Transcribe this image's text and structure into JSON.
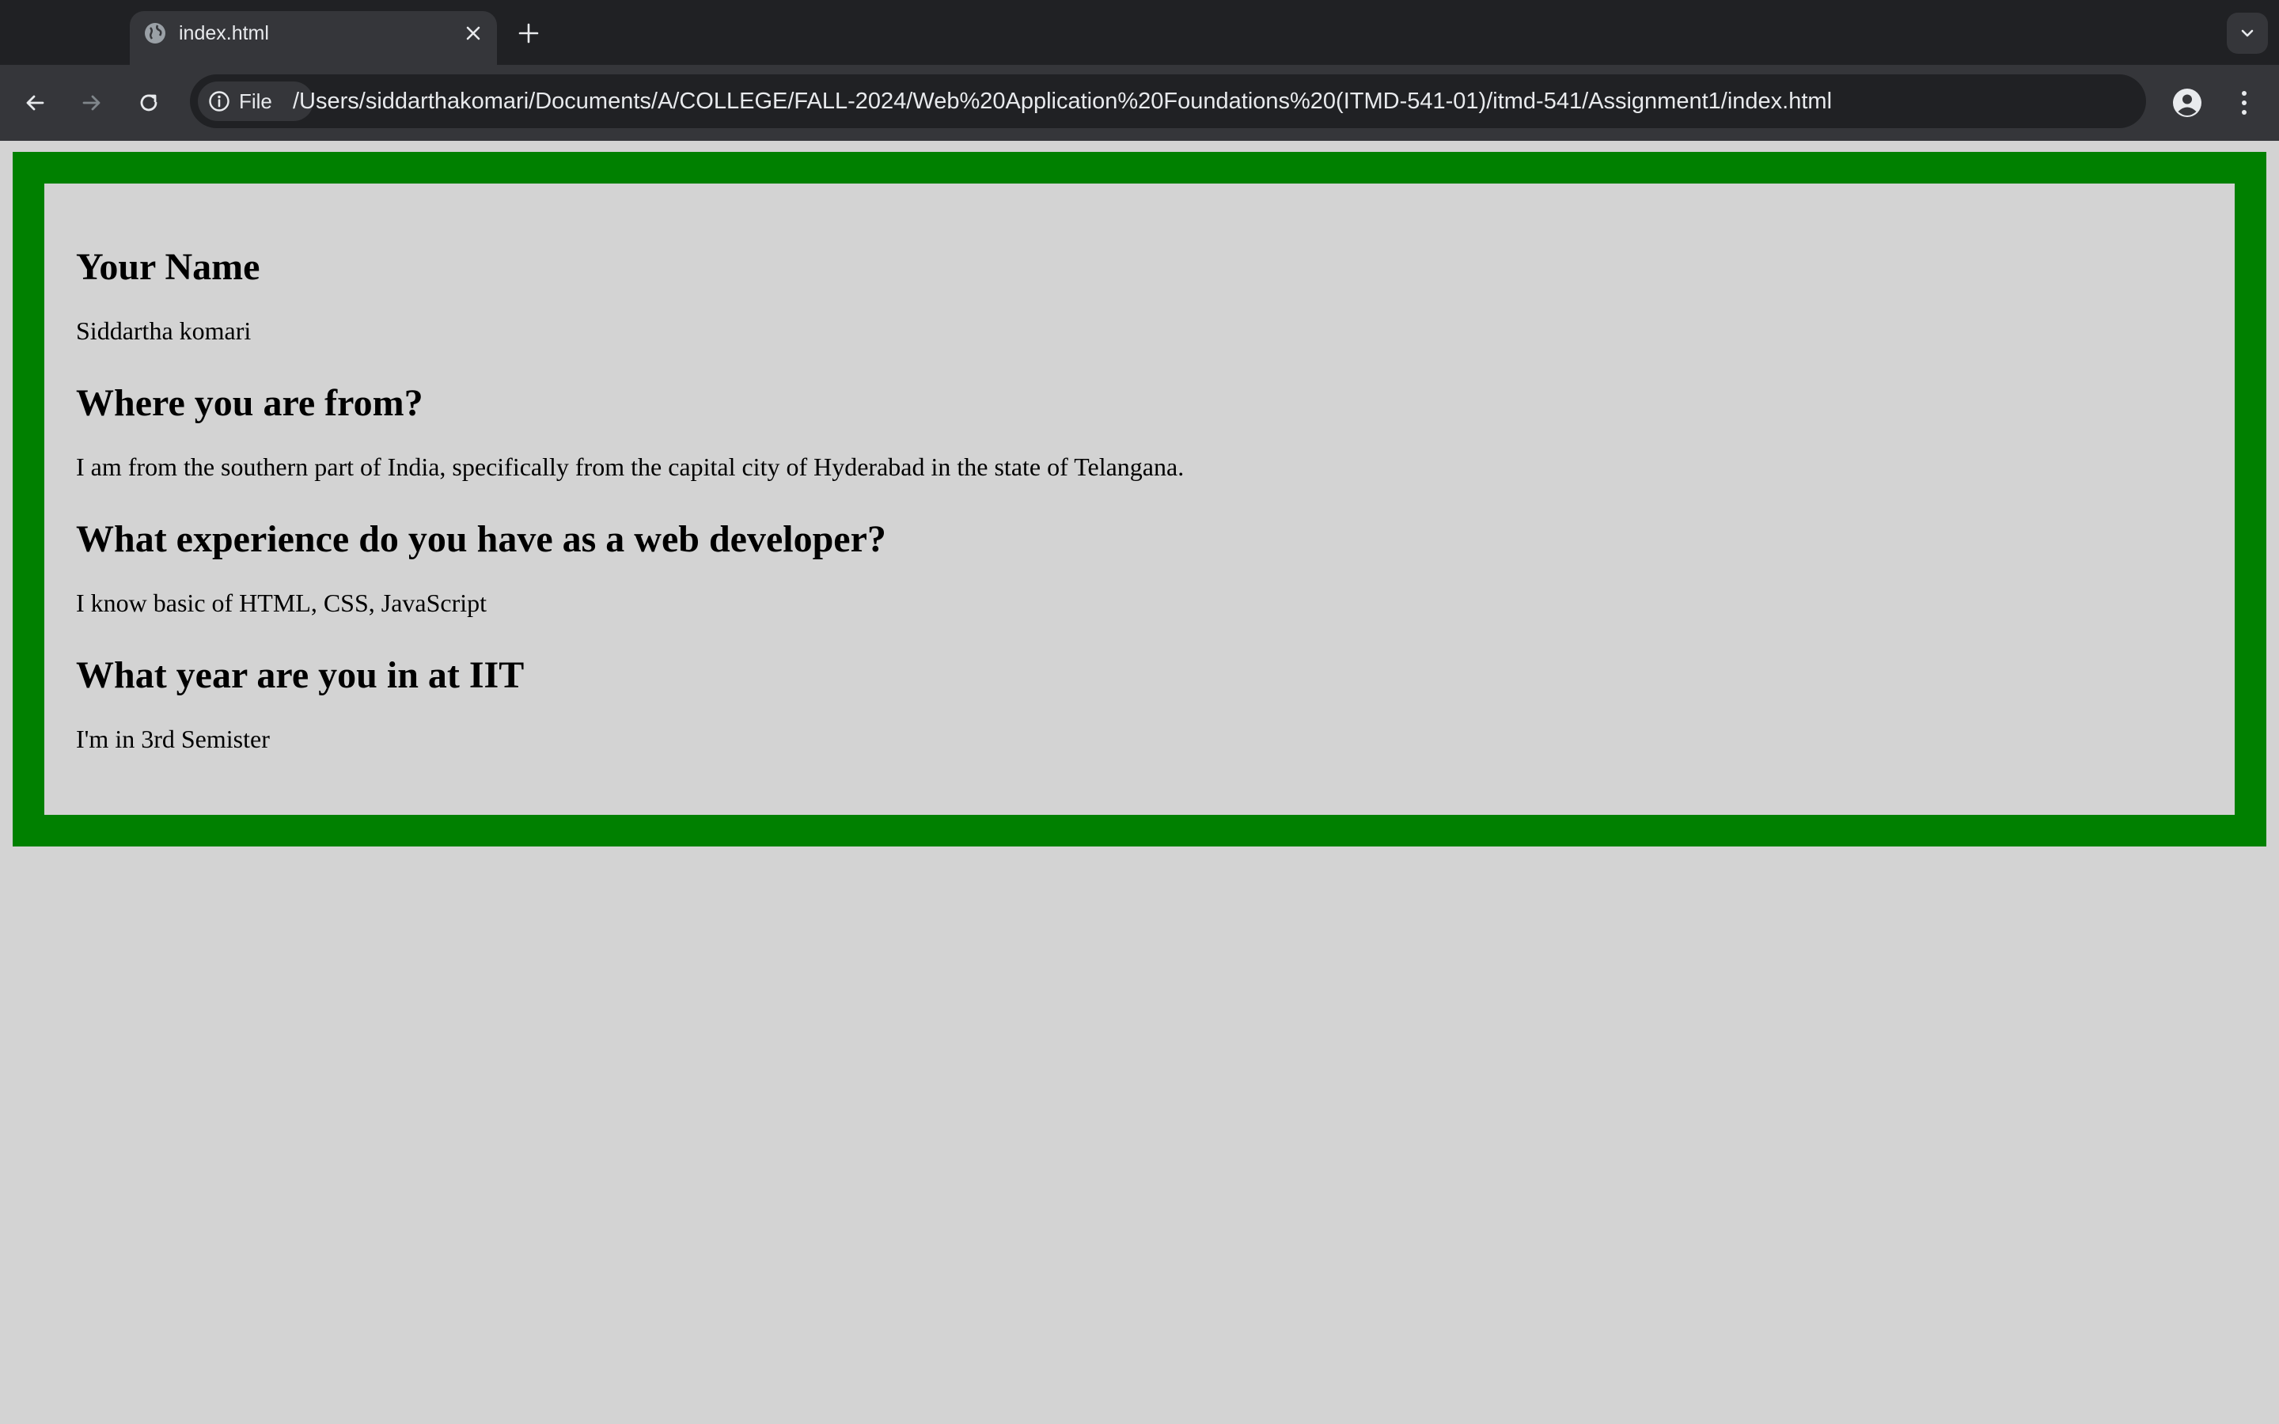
{
  "browser": {
    "tab": {
      "title": "index.html"
    },
    "omnibox": {
      "chip_label": "File",
      "url": "/Users/siddarthakomari/Documents/A/COLLEGE/FALL-2024/Web%20Application%20Foundations%20(ITMD-541-01)/itmd-541/Assignment1/index.html"
    },
    "icons": {
      "tab_favicon": "globe-icon",
      "tab_close": "close-icon",
      "new_tab": "plus-icon",
      "tab_search": "chevron-down-icon",
      "back": "arrow-left-icon",
      "forward": "arrow-right-icon",
      "reload": "reload-icon",
      "site_info": "info-icon",
      "bookmark": "star-icon",
      "profile": "profile-icon",
      "menu": "kebab-menu-icon"
    }
  },
  "page": {
    "colors": {
      "background": "#d3d3d3",
      "border": "#008000"
    },
    "sections": [
      {
        "heading": "Your Name",
        "text": "Siddartha komari"
      },
      {
        "heading": "Where you are from?",
        "text": "I am from the southern part of India, specifically from the capital city of Hyderabad in the state of Telangana."
      },
      {
        "heading": "What experience do you have as a web developer?",
        "text": "I know basic of HTML, CSS, JavaScript"
      },
      {
        "heading": "What year are you in at IIT",
        "text": "I'm in 3rd Semister"
      }
    ]
  }
}
